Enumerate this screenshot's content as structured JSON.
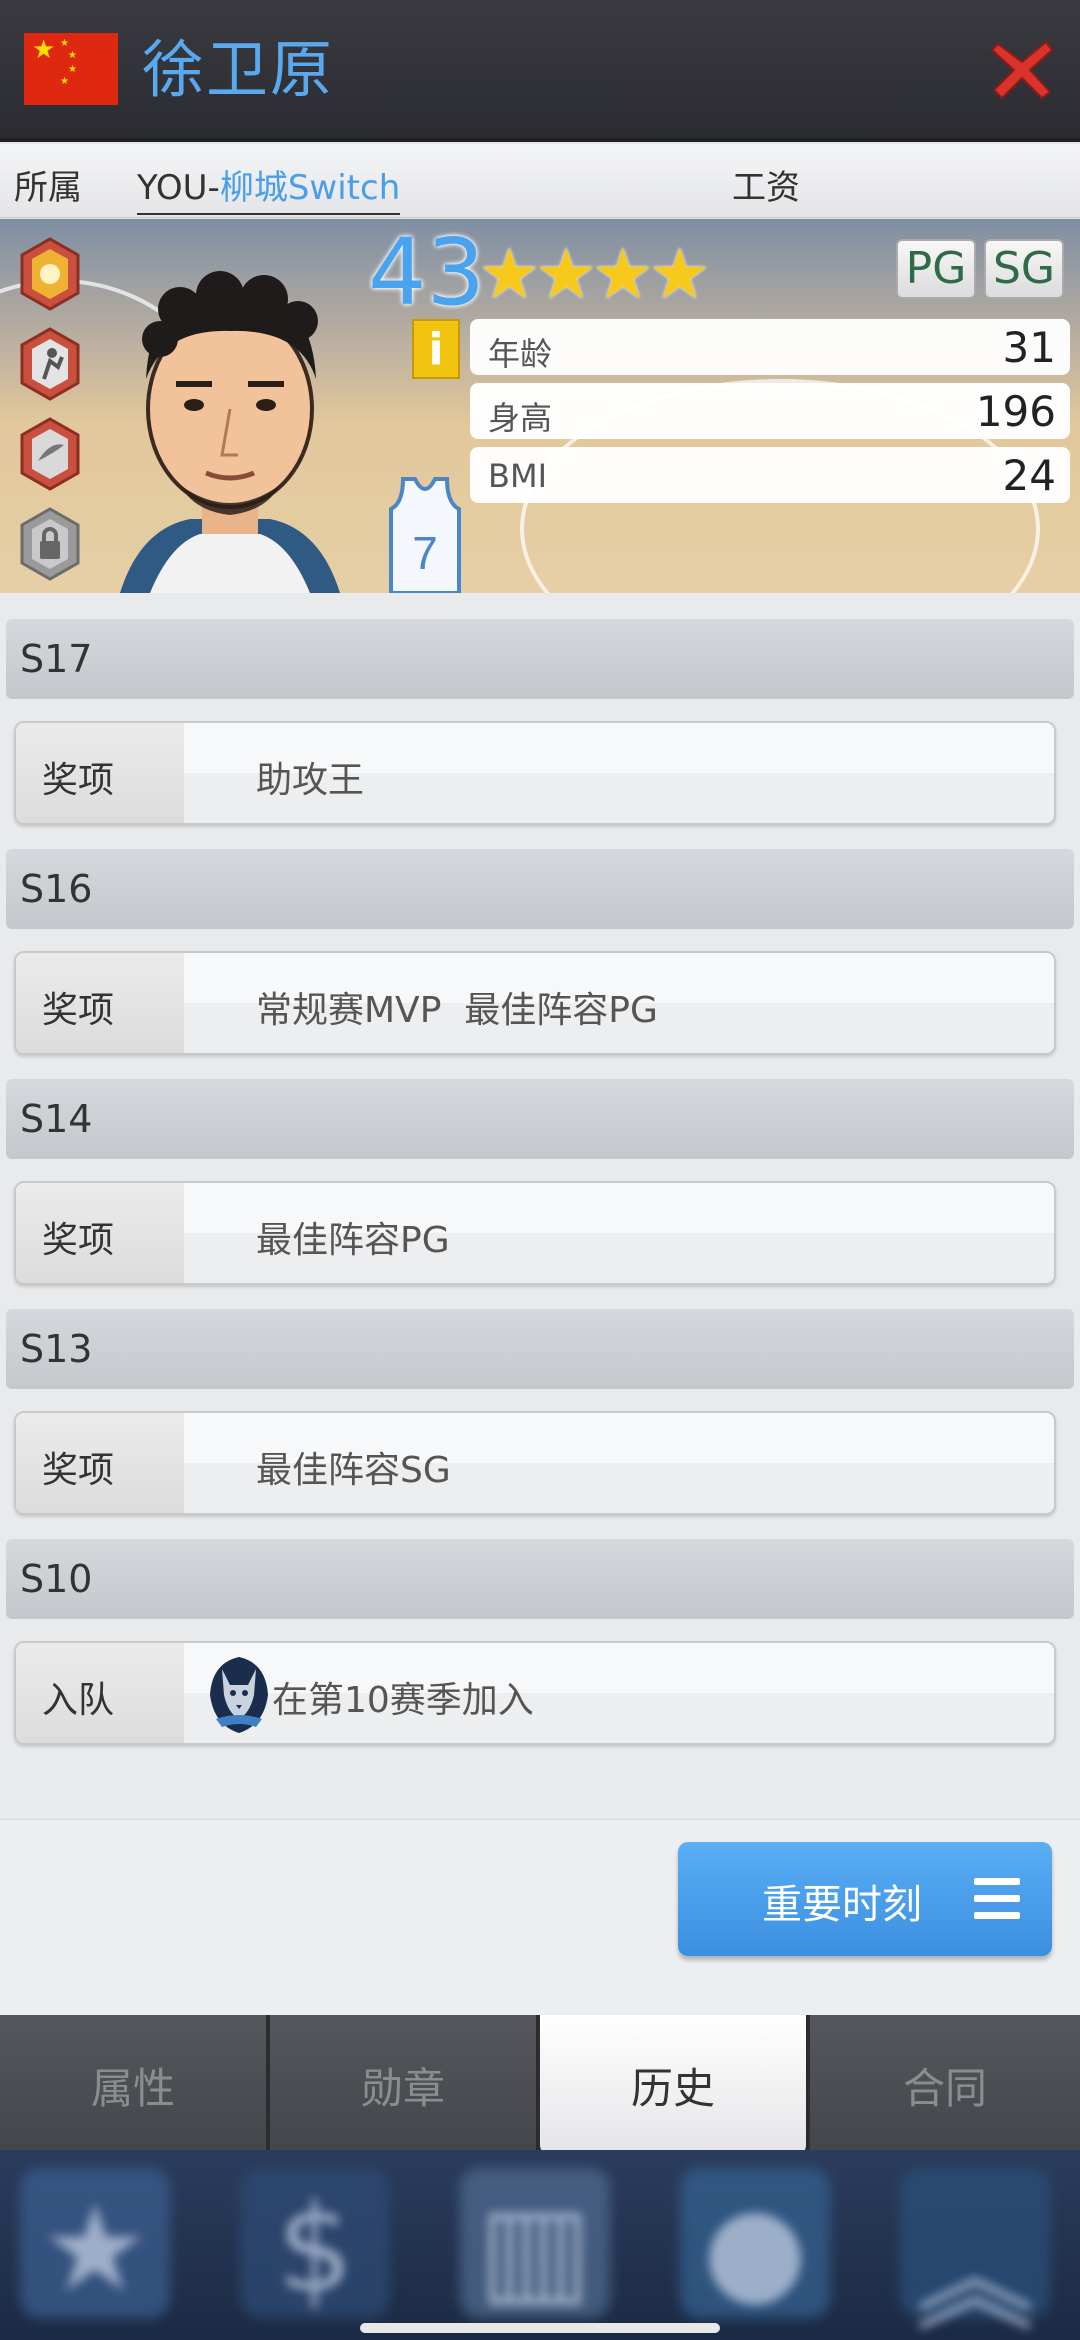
{
  "header": {
    "player_name": "徐卫原",
    "flag_icon": "china-flag-icon",
    "close_icon": "close-x-icon"
  },
  "affiliation": {
    "label": "所属",
    "team_prefix": "YOU-",
    "team_name": "柳城Switch",
    "salary_label": "工资"
  },
  "player_card": {
    "rating": "43",
    "stars": 4,
    "star_glyphs": "★★★★",
    "positions": [
      "PG",
      "SG"
    ],
    "info_icon_label": "i",
    "jersey_number": "7",
    "stats": [
      {
        "label": "年龄",
        "value": "31"
      },
      {
        "label": "身高",
        "value": "196"
      },
      {
        "label": "BMI",
        "value": "24"
      }
    ]
  },
  "history": [
    {
      "season": "S17",
      "label": "奖项",
      "value": "助攻王"
    },
    {
      "season": "S16",
      "label": "奖项",
      "value": "常规赛MVP  最佳阵容PG"
    },
    {
      "season": "S14",
      "label": "奖项",
      "value": "最佳阵容PG"
    },
    {
      "season": "S13",
      "label": "奖项",
      "value": "最佳阵容SG"
    },
    {
      "season": "S10",
      "label": "入队",
      "value": "在第10赛季加入"
    }
  ],
  "moments_button": {
    "label": "重要时刻"
  },
  "tabs": [
    {
      "label": "属性",
      "active": false
    },
    {
      "label": "勋章",
      "active": false
    },
    {
      "label": "历史",
      "active": true
    },
    {
      "label": "合同",
      "active": false
    }
  ],
  "colors": {
    "accent_blue": "#4a9ee8",
    "close_red": "#d9332b",
    "star_gold": "#f6c91a"
  }
}
